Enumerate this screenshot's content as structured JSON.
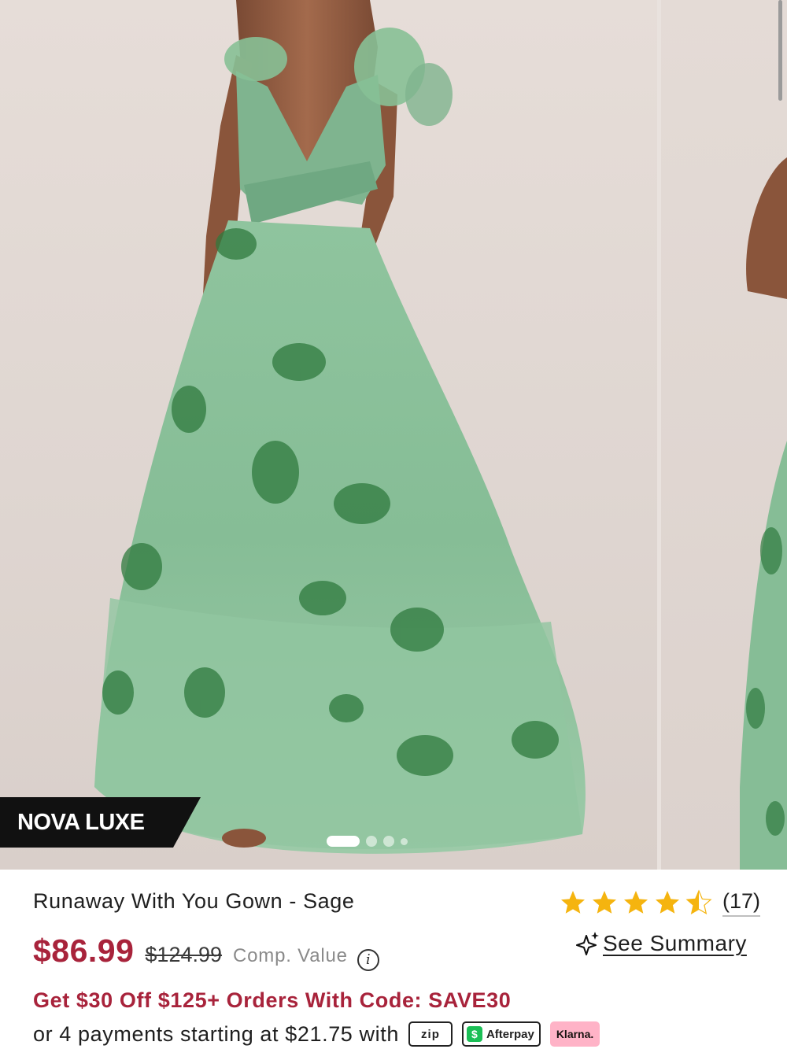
{
  "brand": {
    "label": "NOVA LUXE"
  },
  "gallery": {
    "image_count": 5,
    "active_index": 0
  },
  "product": {
    "title": "Runaway With You Gown - Sage",
    "rating": 4.5,
    "review_count": "(17)",
    "price": "$86.99",
    "comp_price": "$124.99",
    "comp_label": "Comp. Value",
    "summary_link": "See Summary",
    "promo": "Get $30 Off $125+ Orders With Code: SAVE30",
    "payments_text": "or 4 payments starting at $21.75 with",
    "payment_providers": [
      "zip",
      "Afterpay",
      "Klarna."
    ]
  },
  "colors": {
    "price_red": "#a8233b",
    "star_gold": "#f5b40f",
    "dress_green": "#7fb48f",
    "afterpay_green": "#1bbf56",
    "klarna_pink": "#ffb3c7"
  },
  "icons": [
    "share-icon",
    "sparkle-icon",
    "info-icon",
    "star-icon"
  ]
}
